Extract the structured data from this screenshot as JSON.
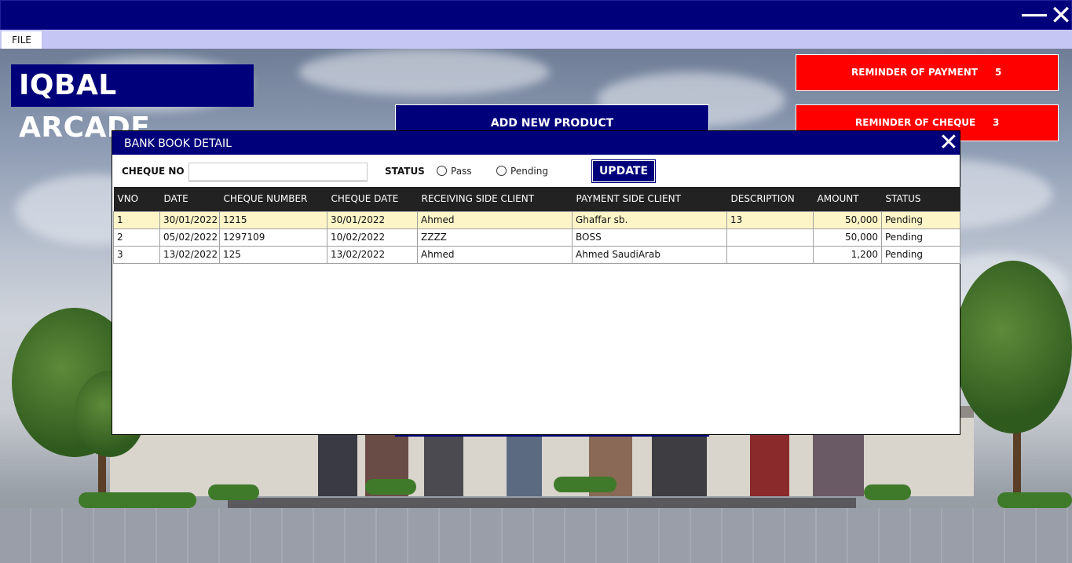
{
  "window": {
    "minimize_icon": "minimize-icon",
    "close_icon": "close-icon"
  },
  "menu": {
    "file_label": "FILE"
  },
  "brand": {
    "title": "IQBAL ARCADE"
  },
  "background_buttons": {
    "add_new_product": "ADD NEW PRODUCT"
  },
  "reminders": [
    {
      "label": "REMINDER OF PAYMENT",
      "count": "5"
    },
    {
      "label": "REMINDER OF CHEQUE",
      "count": "3"
    }
  ],
  "dialog": {
    "title": "BANK BOOK DETAIL",
    "cheque_no_label": "CHEQUE NO",
    "cheque_no_value": "",
    "status_label": "STATUS",
    "status_options": [
      "Pass",
      "Pending"
    ],
    "update_label": "UPDATE",
    "table": {
      "columns": [
        "VNO",
        "DATE",
        "CHEQUE NUMBER",
        "CHEQUE DATE",
        "RECEIVING SIDE CLIENT",
        "PAYMENT SIDE CLIENT",
        "DESCRIPTION",
        "AMOUNT",
        "STATUS"
      ],
      "rows": [
        [
          "1",
          "30/01/2022",
          "1215",
          "30/01/2022",
          "Ahmed",
          "Ghaffar sb.",
          "13",
          "50,000",
          "Pending"
        ],
        [
          "2",
          "05/02/2022",
          "1297109",
          "10/02/2022",
          "ZZZZ",
          "BOSS",
          "",
          "50,000",
          "Pending"
        ],
        [
          "3",
          "13/02/2022",
          "125",
          "13/02/2022",
          "Ahmed",
          "Ahmed SaudiArab",
          "",
          "1,200",
          "Pending"
        ]
      ]
    }
  },
  "colors": {
    "navy": "#00007a",
    "menu_bg": "#c6c6f5",
    "reminder_red": "#ff0000",
    "table_header": "#222222",
    "selected_row": "#fdf5c8"
  }
}
